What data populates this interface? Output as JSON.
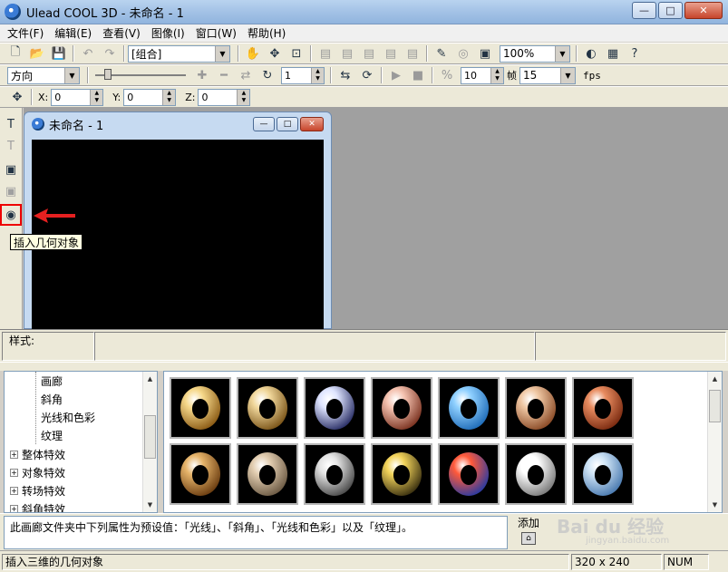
{
  "window": {
    "title": "Ulead COOL 3D - 未命名 - 1",
    "min": "—",
    "max": "□",
    "close": "✕"
  },
  "menu": [
    "文件(F)",
    "编辑(E)",
    "查看(V)",
    "图像(I)",
    "窗口(W)",
    "帮助(H)"
  ],
  "toolbar1": {
    "group_combo": "[组合]",
    "zoom_combo": "100%"
  },
  "toolbar2": {
    "direction_combo": "方向",
    "frame_value": "1",
    "frames_value": "10",
    "frames_label": "帧",
    "fps_value": "15",
    "fps_label": "fps"
  },
  "toolbar3": {
    "x_label": "X:",
    "x_value": "0",
    "y_label": "Y:",
    "y_value": "0",
    "z_label": "Z:",
    "z_value": "0"
  },
  "tooltip": "插入几何对象",
  "document": {
    "title": "未命名 - 1"
  },
  "style_panel": {
    "label": "样式:"
  },
  "tree": {
    "children": [
      "画廊",
      "斜角",
      "光线和色彩",
      "纹理"
    ],
    "groups": [
      "整体特效",
      "对象特效",
      "转场特效",
      "斜角特效"
    ]
  },
  "description": "此画廊文件夹中下列属性为预设值：「光线」、「斜角」、「光线和色彩」以及「纹理」。",
  "add_button": "添加",
  "status": {
    "hint": "插入三维的几何对象",
    "size": "320 x 240",
    "num": "NUM"
  },
  "watermark": {
    "logo": "Bai du 经验",
    "sub": "jingyan.baidu.com"
  },
  "thumbnails": [
    {
      "name": "gold-torus",
      "c1": "#f6d88a",
      "c2": "#8a5a14"
    },
    {
      "name": "brass-torus",
      "c1": "#f1d79b",
      "c2": "#7a5418"
    },
    {
      "name": "chrome-torus",
      "c1": "#dfe5ff",
      "c2": "#2a2f66"
    },
    {
      "name": "copper-torus",
      "c1": "#f4c2b0",
      "c2": "#7a3220"
    },
    {
      "name": "blue-marble-torus",
      "c1": "#8fd0ff",
      "c2": "#1f6cb8"
    },
    {
      "name": "wood-torus",
      "c1": "#f0c8a4",
      "c2": "#8a4a26"
    },
    {
      "name": "brick-torus",
      "c1": "#e88c60",
      "c2": "#7a2a10"
    },
    {
      "name": "brass-hole-torus",
      "c1": "#e6b46a",
      "c2": "#6a3c10"
    },
    {
      "name": "stone-hole-torus",
      "c1": "#e2cdb0",
      "c2": "#6c5a44"
    },
    {
      "name": "chain-torus",
      "c1": "#e4e4e4",
      "c2": "#4a4a4a"
    },
    {
      "name": "checker-torus",
      "c1": "#f2d35a",
      "c2": "#3a3010"
    },
    {
      "name": "mosaic-torus",
      "c1": "#ff5a3a",
      "c2": "#2a3aa0"
    },
    {
      "name": "white-torus",
      "c1": "#ffffff",
      "c2": "#7a7a7a"
    },
    {
      "name": "cloud-torus",
      "c1": "#cfe4f6",
      "c2": "#4a7ab0"
    }
  ]
}
